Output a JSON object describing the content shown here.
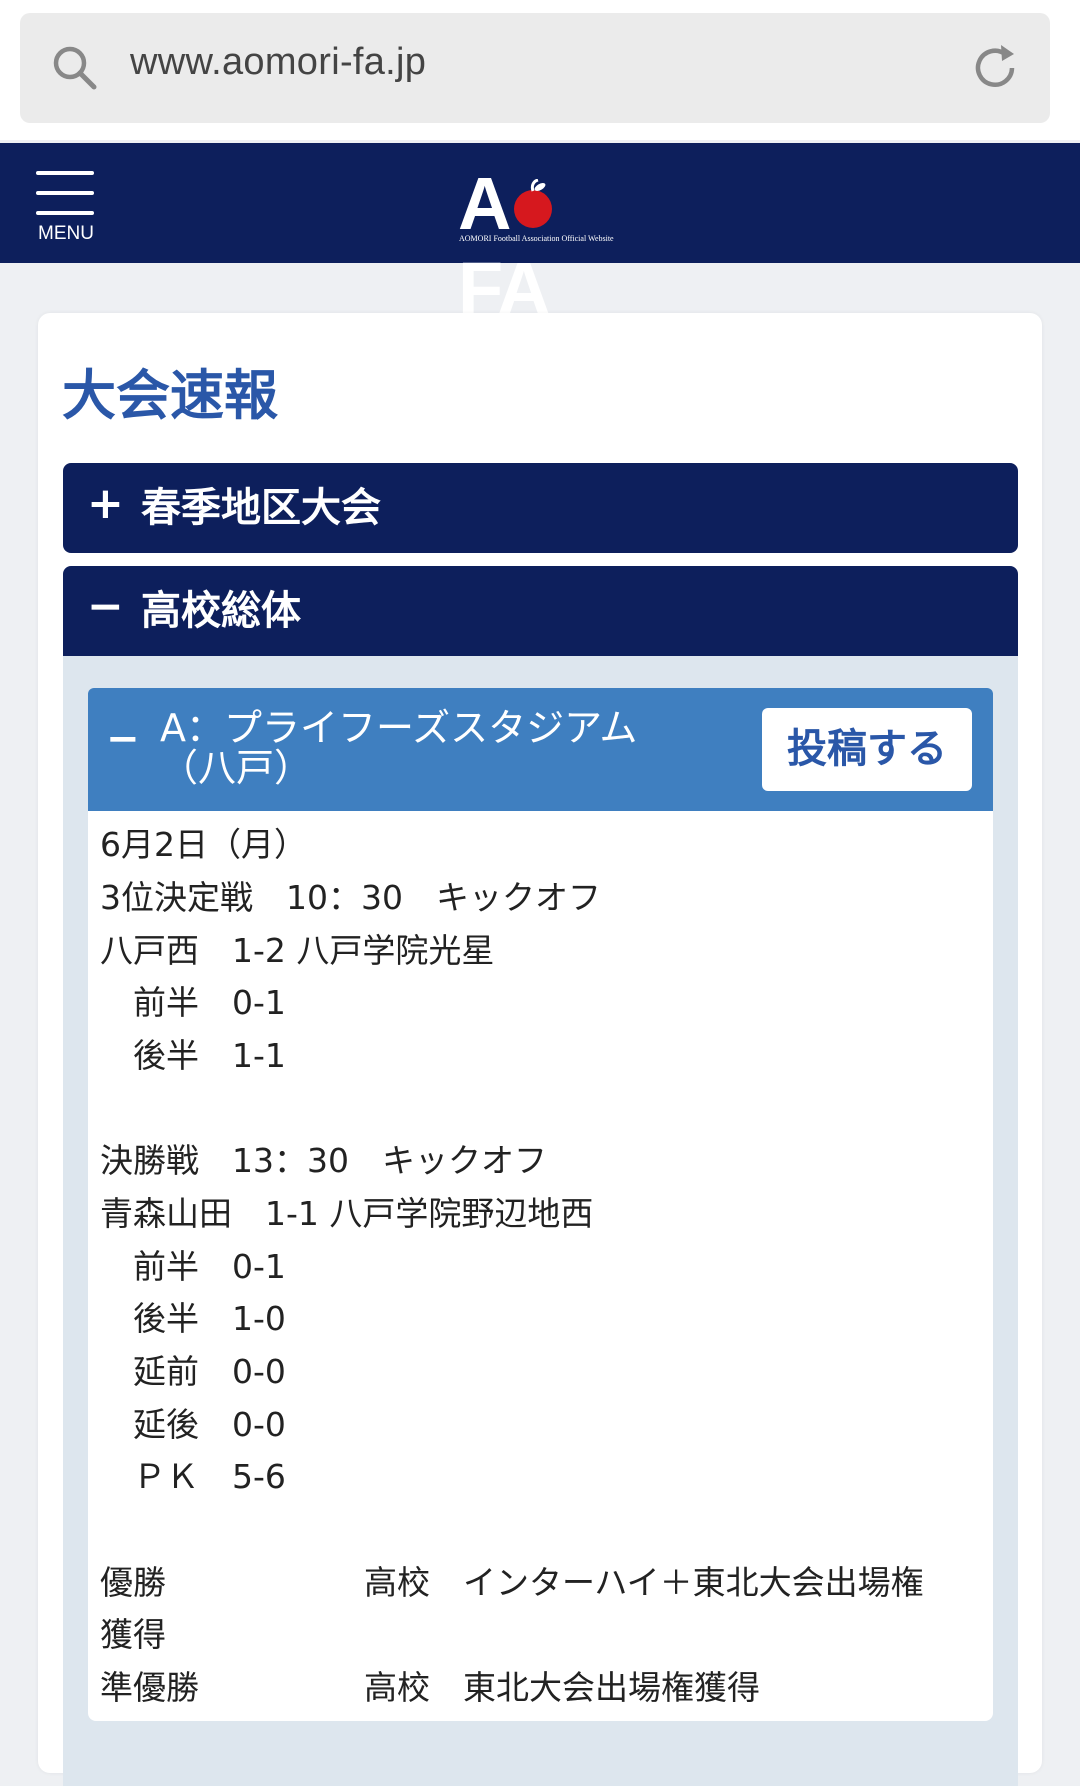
{
  "browser": {
    "url": "www.aomori-fa.jp",
    "search_icon": "search-icon",
    "reload_icon": "reload-icon"
  },
  "header": {
    "menu_label": "MENU",
    "logo_text": "A FA",
    "logo_subtitle": "AOMORI Football Association Official Website",
    "colors": {
      "navy": "#0d1f5c",
      "apple_red": "#d6181e"
    }
  },
  "page": {
    "title": "大会速報",
    "accordions": [
      {
        "symbol": "+",
        "label": "春季地区大会",
        "expanded": false
      },
      {
        "symbol": "−",
        "label": "高校総体",
        "expanded": true
      }
    ],
    "venue": {
      "symbol": "−",
      "label": "A：プライフーズスタジアム（八戸）",
      "post_button": "投稿する"
    },
    "lines": [
      "6月2日（月）",
      "3位決定戦　10：30　キックオフ",
      "八戸西　1‐2 八戸学院光星",
      "　前半　0‐1",
      "　後半　1‐1",
      "",
      "決勝戦　13：30　キックオフ",
      "青森山田　1‐1 八戸学院野辺地西",
      "　前半　0‐1",
      "　後半　1‐0",
      "　延前　0-0",
      "　延後　0-0",
      "　ＰＫ　5-6",
      "",
      "優勝　　　　　　高校　インターハイ＋東北大会出場権",
      "獲得",
      "準優勝　　　　　高校　東北大会出場権獲得"
    ]
  }
}
